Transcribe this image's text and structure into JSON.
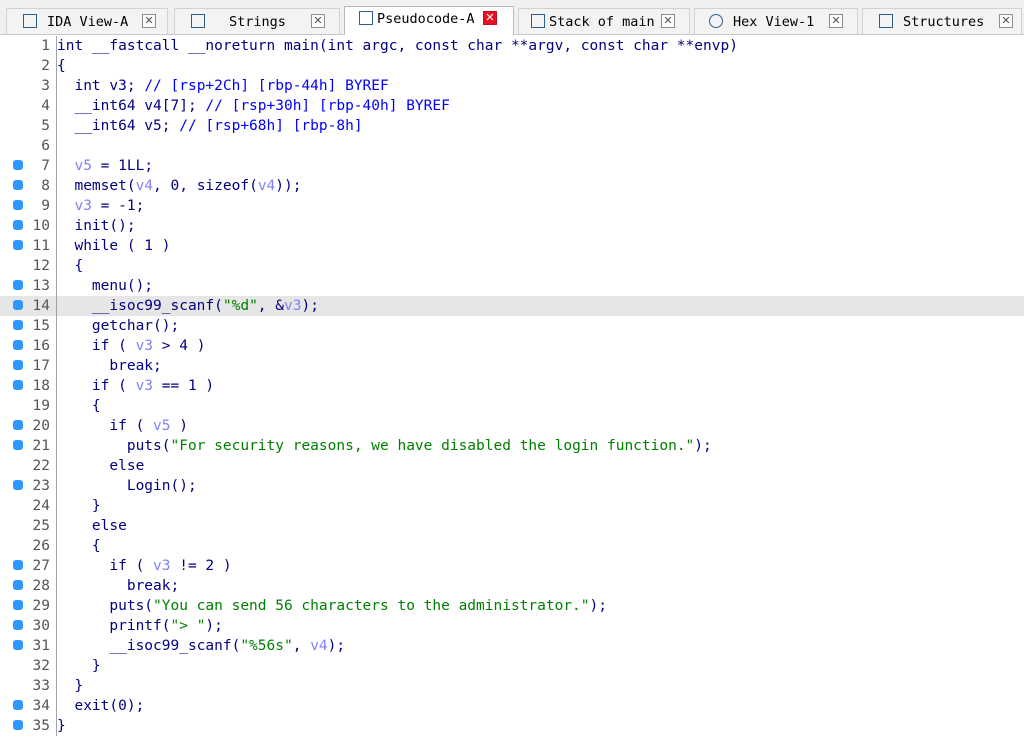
{
  "tabs": [
    {
      "name": "tab-ida-view",
      "icon": "ida-view-icon",
      "label": "IDA View-A",
      "active": false
    },
    {
      "name": "tab-strings",
      "icon": "strings-icon",
      "label": "Strings",
      "active": false
    },
    {
      "name": "tab-pseudocode",
      "icon": "pseudocode-icon",
      "label": "Pseudocode-A",
      "active": true
    },
    {
      "name": "tab-stack-of-main",
      "icon": "stack-icon",
      "label": "Stack of main",
      "active": false
    },
    {
      "name": "tab-hex-view",
      "icon": "hex-view-icon",
      "label": "Hex View-1",
      "active": false
    },
    {
      "name": "tab-structures",
      "icon": "structures-icon",
      "label": "Structures",
      "active": false
    }
  ],
  "tab_close_glyph": "✕",
  "colors": {
    "keyword": "#000080",
    "comment": "#0000ff",
    "variable": "#8080ff",
    "string": "#008000",
    "breakpoint_dot": "#2f98ff",
    "highlight_line": "#e6e6e6",
    "active_close": "#e81123"
  },
  "highlighted_line": 14,
  "code": {
    "lines": [
      {
        "n": "1",
        "bp": false,
        "segs": [
          [
            "k",
            "int __fastcall __noreturn main(int argc, const char **argv, const char **envp)"
          ]
        ]
      },
      {
        "n": "2",
        "bp": false,
        "segs": [
          [
            "k",
            "{"
          ]
        ]
      },
      {
        "n": "3",
        "bp": false,
        "segs": [
          [
            "k",
            "  int v3; "
          ],
          [
            "c",
            "// [rsp+2Ch] [rbp-44h] BYREF"
          ]
        ]
      },
      {
        "n": "4",
        "bp": false,
        "segs": [
          [
            "k",
            "  __int64 v4[7]; "
          ],
          [
            "c",
            "// [rsp+30h] [rbp-40h] BYREF"
          ]
        ]
      },
      {
        "n": "5",
        "bp": false,
        "segs": [
          [
            "k",
            "  __int64 v5; "
          ],
          [
            "c",
            "// [rsp+68h] [rbp-8h]"
          ]
        ]
      },
      {
        "n": "6",
        "bp": false,
        "segs": [
          [
            "k",
            ""
          ]
        ]
      },
      {
        "n": "7",
        "bp": true,
        "segs": [
          [
            "k",
            "  "
          ],
          [
            "v",
            "v5"
          ],
          [
            "k",
            " = 1LL;"
          ]
        ]
      },
      {
        "n": "8",
        "bp": true,
        "segs": [
          [
            "k",
            "  memset("
          ],
          [
            "v",
            "v4"
          ],
          [
            "k",
            ", 0, sizeof("
          ],
          [
            "v",
            "v4"
          ],
          [
            "k",
            "));"
          ]
        ]
      },
      {
        "n": "9",
        "bp": true,
        "segs": [
          [
            "k",
            "  "
          ],
          [
            "v",
            "v3"
          ],
          [
            "k",
            " = -1;"
          ]
        ]
      },
      {
        "n": "10",
        "bp": true,
        "segs": [
          [
            "k",
            "  init();"
          ]
        ]
      },
      {
        "n": "11",
        "bp": true,
        "segs": [
          [
            "k",
            "  while ( 1 )"
          ]
        ]
      },
      {
        "n": "12",
        "bp": false,
        "segs": [
          [
            "k",
            "  {"
          ]
        ]
      },
      {
        "n": "13",
        "bp": true,
        "segs": [
          [
            "k",
            "    menu();"
          ]
        ]
      },
      {
        "n": "14",
        "bp": true,
        "segs": [
          [
            "k",
            "    __isoc99_scanf("
          ],
          [
            "s",
            "\"%d\""
          ],
          [
            "k",
            ", &"
          ],
          [
            "v",
            "v3"
          ],
          [
            "k",
            ");"
          ]
        ]
      },
      {
        "n": "15",
        "bp": true,
        "segs": [
          [
            "k",
            "    getchar();"
          ]
        ]
      },
      {
        "n": "16",
        "bp": true,
        "segs": [
          [
            "k",
            "    if ( "
          ],
          [
            "v",
            "v3"
          ],
          [
            "k",
            " > 4 )"
          ]
        ]
      },
      {
        "n": "17",
        "bp": true,
        "segs": [
          [
            "k",
            "      break;"
          ]
        ]
      },
      {
        "n": "18",
        "bp": true,
        "segs": [
          [
            "k",
            "    if ( "
          ],
          [
            "v",
            "v3"
          ],
          [
            "k",
            " == 1 )"
          ]
        ]
      },
      {
        "n": "19",
        "bp": false,
        "segs": [
          [
            "k",
            "    {"
          ]
        ]
      },
      {
        "n": "20",
        "bp": true,
        "segs": [
          [
            "k",
            "      if ( "
          ],
          [
            "v",
            "v5"
          ],
          [
            "k",
            " )"
          ]
        ]
      },
      {
        "n": "21",
        "bp": true,
        "segs": [
          [
            "k",
            "        puts("
          ],
          [
            "s",
            "\"For security reasons, we have disabled the login function.\""
          ],
          [
            "k",
            ");"
          ]
        ]
      },
      {
        "n": "22",
        "bp": false,
        "segs": [
          [
            "k",
            "      else"
          ]
        ]
      },
      {
        "n": "23",
        "bp": true,
        "segs": [
          [
            "k",
            "        Login();"
          ]
        ]
      },
      {
        "n": "24",
        "bp": false,
        "segs": [
          [
            "k",
            "    }"
          ]
        ]
      },
      {
        "n": "25",
        "bp": false,
        "segs": [
          [
            "k",
            "    else"
          ]
        ]
      },
      {
        "n": "26",
        "bp": false,
        "segs": [
          [
            "k",
            "    {"
          ]
        ]
      },
      {
        "n": "27",
        "bp": true,
        "segs": [
          [
            "k",
            "      if ( "
          ],
          [
            "v",
            "v3"
          ],
          [
            "k",
            " != 2 )"
          ]
        ]
      },
      {
        "n": "28",
        "bp": true,
        "segs": [
          [
            "k",
            "        break;"
          ]
        ]
      },
      {
        "n": "29",
        "bp": true,
        "segs": [
          [
            "k",
            "      puts("
          ],
          [
            "s",
            "\"You can send 56 characters to the administrator.\""
          ],
          [
            "k",
            ");"
          ]
        ]
      },
      {
        "n": "30",
        "bp": true,
        "segs": [
          [
            "k",
            "      printf("
          ],
          [
            "s",
            "\"> \""
          ],
          [
            "k",
            ");"
          ]
        ]
      },
      {
        "n": "31",
        "bp": true,
        "segs": [
          [
            "k",
            "      __isoc99_scanf("
          ],
          [
            "s",
            "\"%56s\""
          ],
          [
            "k",
            ", "
          ],
          [
            "v",
            "v4"
          ],
          [
            "k",
            ");"
          ]
        ]
      },
      {
        "n": "32",
        "bp": false,
        "segs": [
          [
            "k",
            "    }"
          ]
        ]
      },
      {
        "n": "33",
        "bp": false,
        "segs": [
          [
            "k",
            "  }"
          ]
        ]
      },
      {
        "n": "34",
        "bp": true,
        "segs": [
          [
            "k",
            "  exit(0);"
          ]
        ]
      },
      {
        "n": "35",
        "bp": true,
        "segs": [
          [
            "k",
            "}"
          ]
        ]
      }
    ]
  }
}
